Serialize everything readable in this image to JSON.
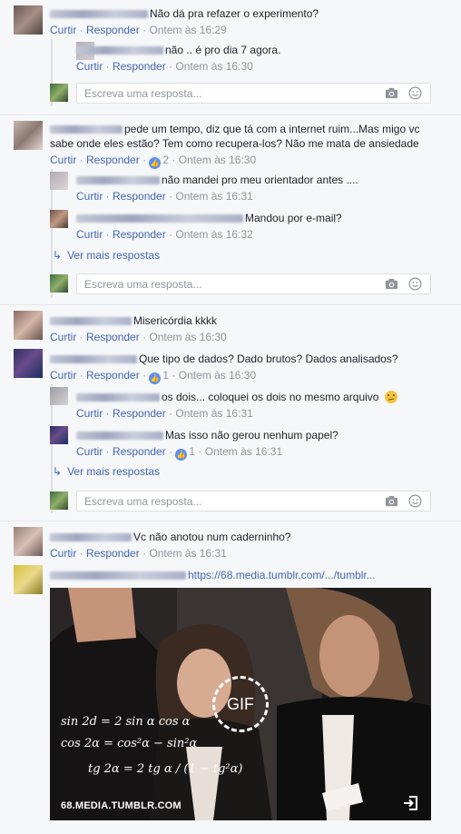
{
  "actions": {
    "like": "Curtir",
    "reply": "Responder"
  },
  "reply_placeholder": "Escreva uma resposta...",
  "more_replies": "Ver mais respostas",
  "comments": [
    {
      "text": "Não dá pra refazer o experimento?",
      "time": "Ontem às 16:29"
    },
    {
      "text": "não .. é pro dia 7 agora.",
      "time": "Ontem às 16:30"
    },
    {
      "text1": "pede um tempo, diz que tá com a internet ruim...Mas migo vc",
      "text2": "sabe onde eles estão? Tem como recupera-los? Não me mata de ansiedade",
      "likes": "2",
      "time": "Ontem às 16:30"
    },
    {
      "text": "não mandei pro meu orientador antes ....",
      "time": "Ontem às 16:31"
    },
    {
      "text": "Mandou por e-mail?",
      "time": "Ontem às 16:32"
    },
    {
      "text": "Misericórdia kkkk",
      "time": "Ontem às 16:30"
    },
    {
      "text": "Que tipo de dados? Dado brutos? Dados analisados?",
      "likes": "1",
      "time": "Ontem às 16:30"
    },
    {
      "text": "os dois... coloquei os dois no mesmo arquivo",
      "time": "Ontem às 16:31"
    },
    {
      "text": "Mas isso não gerou nenhum papel?",
      "likes": "1",
      "time": "Ontem às 16:31"
    },
    {
      "text": "Vc não anotou num caderninho?",
      "time": "Ontem às 16:31"
    },
    {
      "link": "https://68.media.tumblr.com/.../tumblr..."
    }
  ],
  "gif": {
    "badge": "GIF",
    "source": "68.MEDIA.TUMBLR.COM"
  },
  "colors": {
    "link": "#4267b2",
    "meta": "#90949c",
    "like_badge": "#5890ff",
    "background": "#f6f7f9"
  }
}
